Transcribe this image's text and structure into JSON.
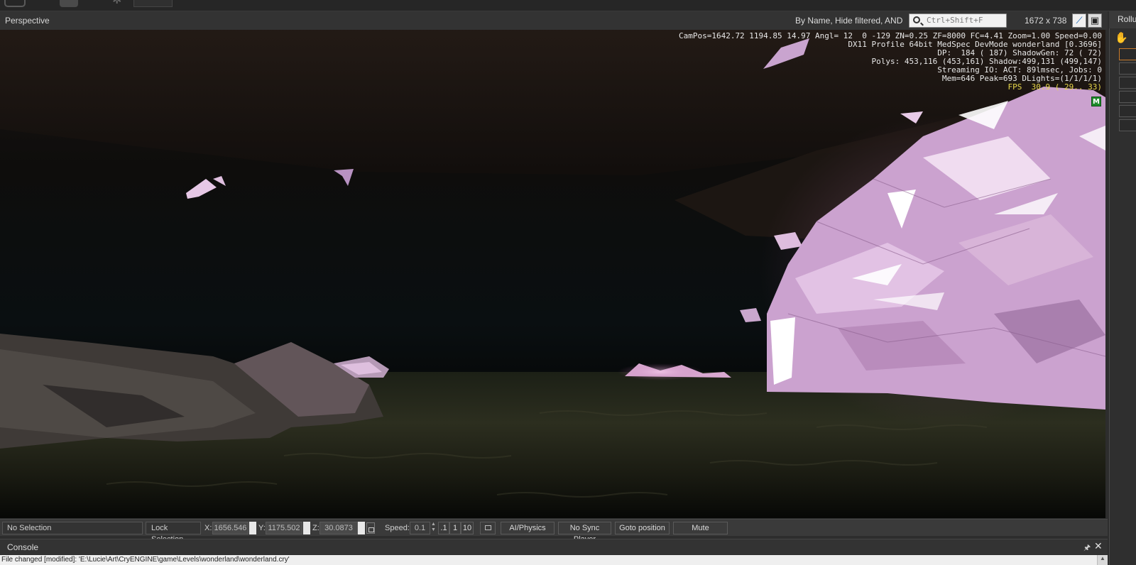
{
  "viewport": {
    "title": "Perspective",
    "filter_text": "By Name, Hide filtered, AND",
    "search_placeholder": "Ctrl+Shift+F",
    "resolution": "1672 x 738",
    "toggle_button_icon": "pin-icon",
    "maximize_button_icon": "maximize-icon"
  },
  "hud": {
    "line1": "CamPos=1642.72 1194.85 14.97 Angl= 12  0 -129 ZN=0.25 ZF=8000 FC=4.41 Zoom=1.00 Speed=0.00",
    "line2": "DX11 Profile 64bit MedSpec DevMode wonderland [0.3696]",
    "line3": "DP:  184 ( 187) ShadowGen: 72 ( 72)",
    "line4": "Polys: 453,116 (453,161) Shadow:499,131 (499,147)",
    "line5": "Streaming IO: ACT: 89lmsec, Jobs: 0",
    "line6": "Mem=646 Peak=693 DLights=(1/1/1/1)",
    "fps": "FPS  30.9 ( 29.. 33)",
    "marker": "M"
  },
  "rollup": {
    "label": "Rollu"
  },
  "statusbar": {
    "selection": "No Selection",
    "lock_selection": "Lock Selection",
    "x_label": "X:",
    "x_value": "1656.546",
    "y_label": "Y:",
    "y_value": "1175.502",
    "z_label": "Z:",
    "z_value": "30.0873",
    "speed_label": "Speed:",
    "speed_value": "0.1",
    "speed_preset_1": ".1",
    "speed_preset_2": "1",
    "speed_preset_3": "10",
    "ai_physics": "AI/Physics",
    "no_sync_player": "No Sync Player",
    "goto_position": "Goto position",
    "mute": "Mute"
  },
  "console": {
    "title": "Console",
    "line": "File changed [modified]: 'E:\\Lucie\\Art\\CryENGINE\\game\\Levels\\wonderland\\wonderland.cry'"
  }
}
